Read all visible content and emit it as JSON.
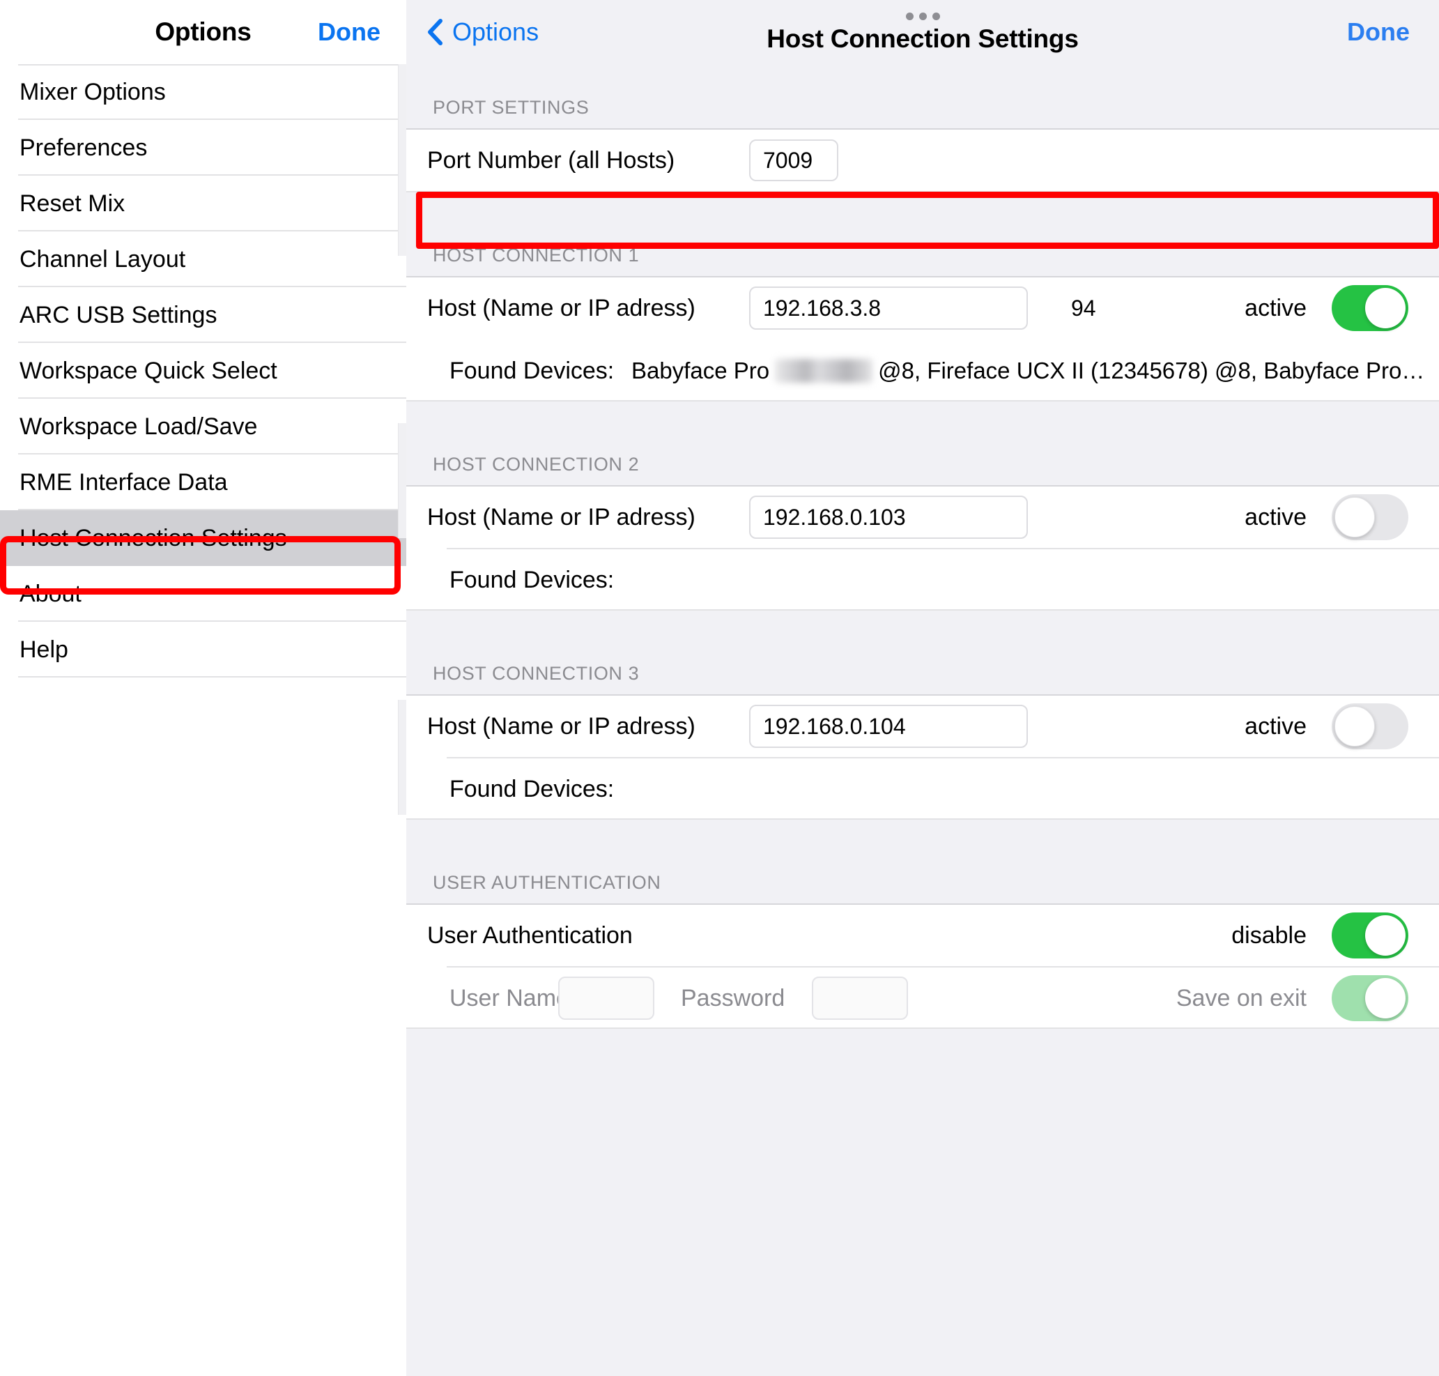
{
  "sidebar": {
    "title": "Options",
    "done_label": "Done",
    "items": [
      {
        "label": "Mixer Options",
        "selected": false
      },
      {
        "label": "Preferences",
        "selected": false
      },
      {
        "label": "Reset Mix",
        "selected": false
      },
      {
        "label": "Channel Layout",
        "selected": false
      },
      {
        "label": "ARC USB Settings",
        "selected": false
      },
      {
        "label": "Workspace Quick Select",
        "selected": false
      },
      {
        "label": "Workspace Load/Save",
        "selected": false
      },
      {
        "label": "RME Interface Data",
        "selected": false
      },
      {
        "label": "Host Connection Settings",
        "selected": true
      },
      {
        "label": "About",
        "selected": false
      },
      {
        "label": "Help",
        "selected": false
      }
    ]
  },
  "main": {
    "back_label": "Options",
    "title": "Host Connection Settings",
    "done_label": "Done",
    "sections": {
      "port_settings": {
        "header": "PORT SETTINGS",
        "port_number_label": "Port Number (all Hosts)",
        "port_number_value": "7009"
      },
      "host1": {
        "header": "HOST CONNECTION 1",
        "host_label": "Host (Name or IP adress)",
        "host_value": "192.168.3.8",
        "extra_number": "94",
        "active_label": "active",
        "active_state": "on",
        "found_devices_label": "Found Devices:",
        "found_devices_prefix": "Babyface Pro",
        "found_devices_suffix": "@8, Fireface UCX II (12345678) @8, Babyface Pro…"
      },
      "host2": {
        "header": "HOST CONNECTION 2",
        "host_label": "Host (Name or IP adress)",
        "host_value": "192.168.0.103",
        "active_label": "active",
        "active_state": "off",
        "found_devices_label": "Found Devices:",
        "found_devices_value": ""
      },
      "host3": {
        "header": "HOST CONNECTION 3",
        "host_label": "Host (Name or IP adress)",
        "host_value": "192.168.0.104",
        "active_label": "active",
        "active_state": "off",
        "found_devices_label": "Found Devices:",
        "found_devices_value": ""
      },
      "user_auth": {
        "header": "USER AUTHENTICATION",
        "auth_label": "User Authentication",
        "auth_state_label": "disable",
        "auth_state": "on",
        "username_label": "User Name",
        "username_value": "",
        "password_label": "Password",
        "password_value": "",
        "save_on_exit_label": "Save on exit",
        "save_on_exit_state": "on-dim"
      }
    }
  },
  "colors": {
    "accent_blue": "#0a74f0",
    "toggle_green": "#25c244",
    "toggle_green_dim": "#9fe0ad",
    "toggle_off": "#e6e6e9",
    "callout_red": "#ff0000",
    "panel_bg": "#f1f1f5",
    "selected_row": "#d0d0d4"
  }
}
